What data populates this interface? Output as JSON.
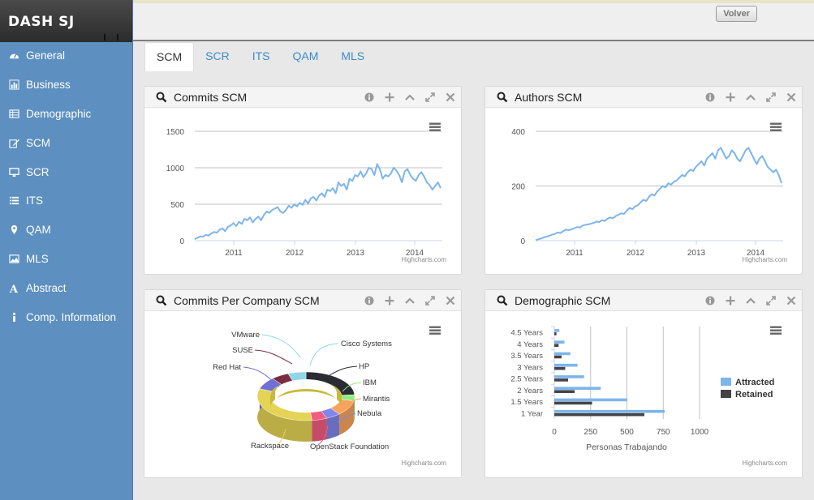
{
  "brand": "DASH SJ",
  "nav": [
    {
      "label": "General",
      "icon": "dashboard-icon"
    },
    {
      "label": "Business",
      "icon": "bar-chart-icon"
    },
    {
      "label": "Demographic",
      "icon": "table-icon"
    },
    {
      "label": "SCM",
      "icon": "edit-icon"
    },
    {
      "label": "SCR",
      "icon": "monitor-icon"
    },
    {
      "label": "ITS",
      "icon": "list-icon"
    },
    {
      "label": "QAM",
      "icon": "map-marker-icon"
    },
    {
      "label": "MLS",
      "icon": "picture-icon"
    },
    {
      "label": "Abstract",
      "icon": "font-icon"
    },
    {
      "label": "Comp. Information",
      "icon": "info-icon"
    }
  ],
  "topbar": {
    "back_label": "Volver"
  },
  "tabs": [
    {
      "label": "SCM",
      "active": true
    },
    {
      "label": "SCR"
    },
    {
      "label": "ITS"
    },
    {
      "label": "QAM"
    },
    {
      "label": "MLS"
    }
  ],
  "credits": "Highcharts.com",
  "panels": {
    "commits": {
      "title": "Commits SCM"
    },
    "authors": {
      "title": "Authors SCM"
    },
    "companies": {
      "title": "Commits Per Company SCM"
    },
    "demographic": {
      "title": "Demographic SCM"
    }
  },
  "chart_data": [
    {
      "type": "line",
      "series": [
        {
          "color": "#7cb5ec",
          "values": [
            20,
            40,
            60,
            55,
            80,
            70,
            100,
            120,
            110,
            150,
            170,
            130,
            190,
            210,
            240,
            200,
            260,
            230,
            300,
            280,
            320,
            250,
            300,
            330,
            280,
            350,
            400,
            380,
            420,
            440,
            460,
            400,
            380,
            420,
            480,
            450,
            500,
            470,
            520,
            490,
            560,
            510,
            580,
            600,
            550,
            620,
            650,
            600,
            700,
            680,
            720,
            650,
            800,
            750,
            780,
            700,
            850,
            820,
            900,
            880,
            950,
            870,
            920,
            1000,
            980,
            900,
            1050,
            980,
            850,
            900,
            880,
            920,
            1000,
            960,
            900,
            800,
            950,
            980,
            900,
            850,
            820,
            900,
            940,
            880,
            800,
            760,
            700,
            750,
            800,
            720
          ]
        }
      ],
      "x_ticks": [
        "2011",
        "2012",
        "2013",
        "2014"
      ],
      "y_ticks": [
        0,
        500,
        1000,
        1500
      ],
      "ylim": [
        0,
        1500
      ]
    },
    {
      "type": "line",
      "series": [
        {
          "color": "#7cb5ec",
          "values": [
            2,
            5,
            8,
            12,
            15,
            18,
            22,
            25,
            30,
            28,
            35,
            40,
            38,
            42,
            45,
            50,
            48,
            55,
            58,
            60,
            62,
            65,
            70,
            68,
            75,
            72,
            80,
            85,
            82,
            90,
            95,
            100,
            98,
            110,
            120,
            115,
            125,
            130,
            140,
            150,
            145,
            160,
            170,
            165,
            180,
            190,
            200,
            195,
            210,
            205,
            215,
            220,
            230,
            240,
            235,
            250,
            260,
            255,
            270,
            280,
            290,
            275,
            300,
            310,
            320,
            300,
            330,
            340,
            320,
            300,
            310,
            330,
            320,
            300,
            290,
            310,
            330,
            340,
            320,
            300,
            280,
            300,
            310,
            290,
            270,
            260,
            250,
            260,
            240,
            210
          ]
        }
      ],
      "x_ticks": [
        "2011",
        "2012",
        "2013",
        "2014"
      ],
      "y_ticks": [
        0,
        200,
        400
      ],
      "ylim": [
        0,
        400
      ]
    },
    {
      "type": "pie",
      "labels": [
        "VMware",
        "SUSE",
        "Red Hat",
        "Cisco Systems",
        "HP",
        "IBM",
        "Mirantis",
        "Nebula",
        "Rackspace",
        "OpenStack Foundation"
      ]
    },
    {
      "type": "bar",
      "categories": [
        "4.5 Years",
        "4 Years",
        "3.5 Years",
        "3 Years",
        "2.5 Years",
        "2 Years",
        "1.5 Years",
        "1 Year"
      ],
      "series": [
        {
          "name": "Attracted",
          "color": "#7cb5ec",
          "values": [
            35,
            70,
            110,
            160,
            205,
            320,
            500,
            760
          ]
        },
        {
          "name": "Retained",
          "color": "#434348",
          "values": [
            15,
            30,
            50,
            75,
            95,
            140,
            260,
            620
          ]
        }
      ],
      "x_ticks": [
        0,
        250,
        500,
        750,
        1000
      ],
      "xlabel": "Personas Trabajando",
      "xlim": [
        0,
        1000
      ]
    }
  ]
}
